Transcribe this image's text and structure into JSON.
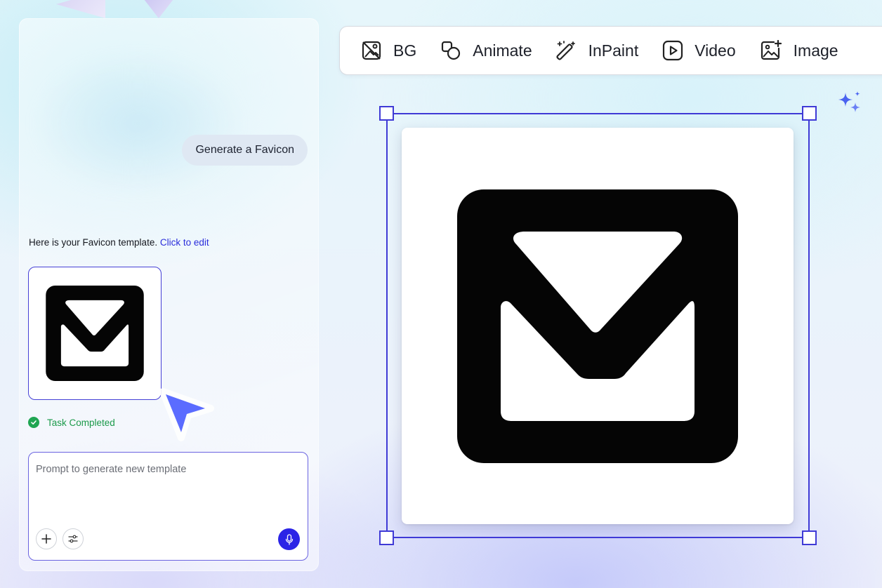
{
  "chat": {
    "user_message": "Generate a Favicon",
    "reply_text": "Here is your Favicon template.",
    "reply_link": "Click to edit",
    "status": "Task Completed",
    "prompt_placeholder": "Prompt to generate new template"
  },
  "toolbar": {
    "items": [
      {
        "label": "BG",
        "icon": "remove-bg-icon"
      },
      {
        "label": "Animate",
        "icon": "shapes-icon"
      },
      {
        "label": "InPaint",
        "icon": "magic-wand-icon"
      },
      {
        "label": "Video",
        "icon": "play-icon"
      },
      {
        "label": "Image",
        "icon": "add-image-icon"
      }
    ]
  },
  "colors": {
    "accent": "#3f3ad6",
    "success": "#1fa552",
    "mic_button": "#2b24e6",
    "cursor": "#5b6cff"
  }
}
